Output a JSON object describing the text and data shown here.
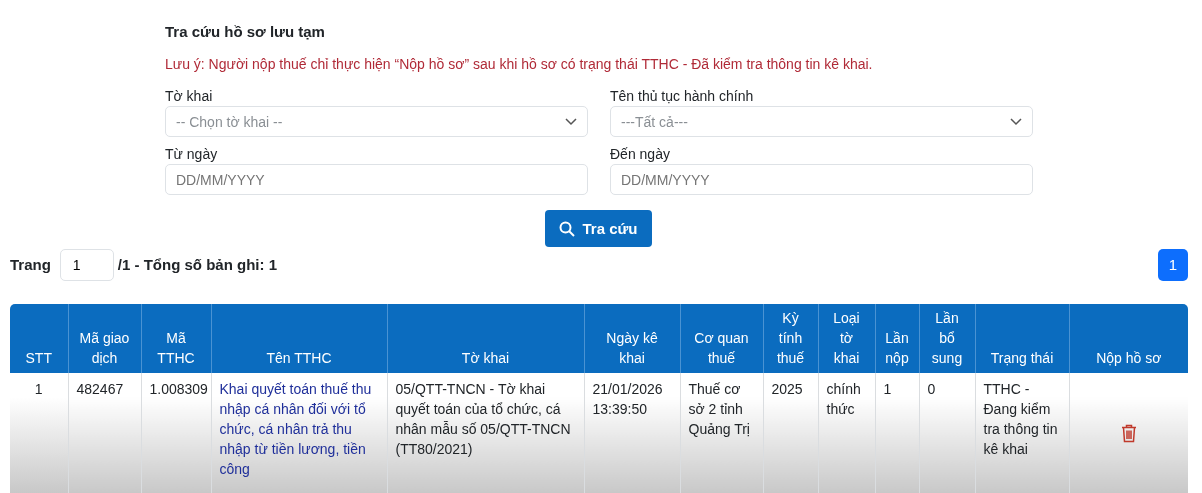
{
  "title": "Tra cứu hồ sơ lưu tạm",
  "note": "Lưu ý: Người nộp thuế chỉ thực hiện “Nộp hồ sơ” sau khi hồ sơ có trạng thái TTHC - Đã kiểm tra thông tin kê khai.",
  "filters": [
    {
      "kind": "select",
      "label": "Tờ khai",
      "placeholder": "-- Chọn tờ khai --"
    },
    {
      "kind": "select",
      "label": "Tên thủ tục hành chính",
      "placeholder": "---Tất cả---"
    },
    {
      "kind": "date",
      "label": "Từ ngày",
      "placeholder": "DD/MM/YYYY"
    },
    {
      "kind": "date",
      "label": "Đến ngày",
      "placeholder": "DD/MM/YYYY"
    }
  ],
  "search_button": "Tra cứu",
  "paging": {
    "label": "Trang",
    "page": "1",
    "total": "/1 - Tổng số bản ghi: 1",
    "pages": [
      {
        "label": "1",
        "selected": true
      }
    ]
  },
  "table": {
    "columns": [
      "STT",
      "Mã giao dịch",
      "Mã TTHC",
      "Tên TTHC",
      "Tờ khai",
      "Ngày kê khai",
      "Cơ quan thuế",
      "Kỳ tính thuế",
      "Loại tờ khai",
      "Lần nộp",
      "Lần bổ sung",
      "Trạng thái",
      "Nộp hồ sơ"
    ],
    "rows": [
      {
        "cells": [
          {
            "kind": "text",
            "text": "1"
          },
          {
            "kind": "text",
            "text": "482467"
          },
          {
            "kind": "text",
            "text": "1.008309"
          },
          {
            "kind": "link",
            "text": "Khai quyết toán thuế thu nhập cá nhân đối với tổ chức, cá nhân trả thu nhập từ tiền lương, tiền công"
          },
          {
            "kind": "text",
            "text": "05/QTT-TNCN - Tờ khai quyết toán của tổ chức, cá nhân mẫu số 05/QTT-TNCN (TT80/2021)"
          },
          {
            "kind": "text",
            "text": "21/01/2026 13:39:50"
          },
          {
            "kind": "text",
            "text": "Thuế cơ sở 2 tỉnh Quảng Trị"
          },
          {
            "kind": "text",
            "text": "2025"
          },
          {
            "kind": "text",
            "text": "chính thức"
          },
          {
            "kind": "text",
            "text": "1"
          },
          {
            "kind": "text",
            "text": "0"
          },
          {
            "kind": "text",
            "text": "TTHC - Đang kiểm tra thông tin kê khai"
          },
          {
            "kind": "delete"
          }
        ]
      }
    ]
  }
}
